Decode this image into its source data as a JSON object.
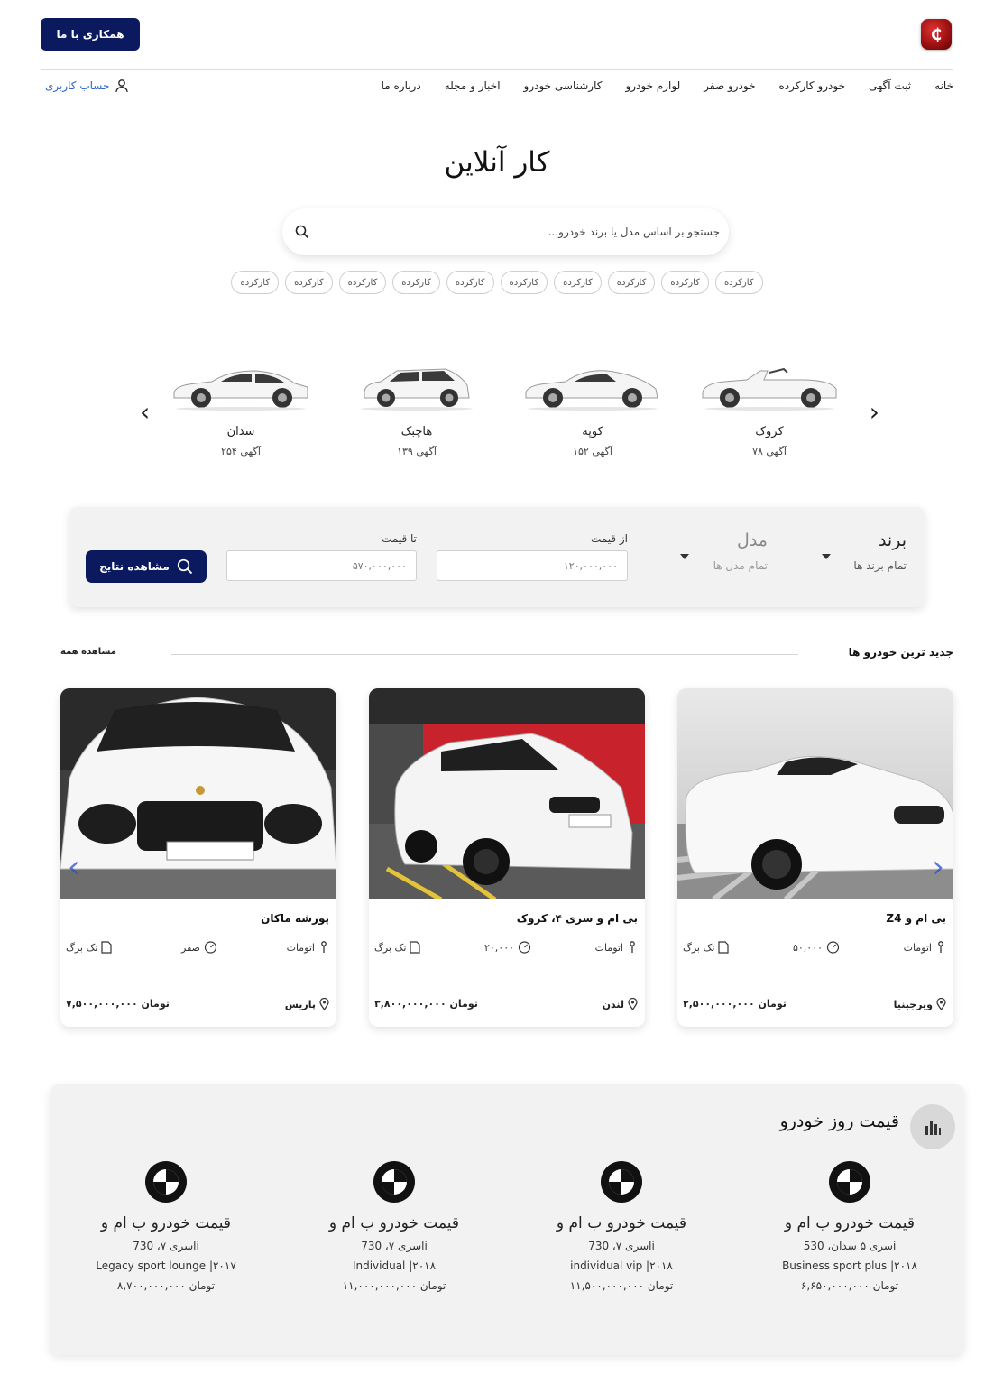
{
  "header": {
    "cta_label": "همکاری با ما",
    "logo_icon": "red-c-logo",
    "logo_glyph": "₵",
    "account_label": "حساب کاربری",
    "nav": [
      "خانه",
      "ثبت آگهی",
      "خودرو کارکرده",
      "خودرو صفر",
      "لوازم خودرو",
      "کارشناسی خودرو",
      "اخبار و مجله",
      "درباره ما"
    ]
  },
  "hero": {
    "title": "کار آنلاین",
    "search_placeholder": "جستجو بر اساس مدل یا برند خودرو...",
    "tags": [
      "کارکرده",
      "کارکرده",
      "کارکرده",
      "کارکرده",
      "کارکرده",
      "کارکرده",
      "کارکرده",
      "کارکرده",
      "کارکرده",
      "کارکرده"
    ]
  },
  "types": [
    {
      "name": "کروک",
      "count": "۷۸ آگهی"
    },
    {
      "name": "کوپه",
      "count": "۱۵۲ آگهی"
    },
    {
      "name": "هاچبک",
      "count": "۱۳۹ آگهی"
    },
    {
      "name": "سدان",
      "count": "۲۵۴ آگهی"
    }
  ],
  "filter": {
    "brand_label": "برند",
    "brand_value": "تمام برند ها",
    "model_label": "مدل",
    "model_value": "تمام مدل ها",
    "from_label": "از قیمت",
    "from_value": "۱۲۰,۰۰۰,۰۰۰",
    "to_label": "تا قیمت",
    "to_value": "۵۷۰,۰۰۰,۰۰۰",
    "results_label": "مشاهده نتایج"
  },
  "newest": {
    "title": "جدید ترین خودرو ها",
    "see_all": "مشاهده همه",
    "cards": [
      {
        "title": "بی ام و Z4",
        "gear": "اتومات",
        "km": "۵۰,۰۰۰",
        "doc": "تک برگ",
        "city": "ویرجینیا",
        "price": "۲,۵۰۰,۰۰۰,۰۰۰ تومان"
      },
      {
        "title": "بی ام و سری ۴، کروک",
        "gear": "اتومات",
        "km": "۲۰,۰۰۰",
        "doc": "تک برگ",
        "city": "لندن",
        "price": "۳,۸۰۰,۰۰۰,۰۰۰ تومان"
      },
      {
        "title": "پورشه ماکان",
        "gear": "اتومات",
        "km": "صفر",
        "doc": "تک برگ",
        "city": "پاریس",
        "price": "۷,۵۰۰,۰۰۰,۰۰۰ تومان"
      }
    ]
  },
  "daily": {
    "title": "قیمت روز خودرو",
    "items": [
      {
        "title": "قیمت خودرو ب ام و",
        "series": "سری ۵ سدان، 530i",
        "trim": "Business sport plus |۲۰۱۸",
        "price": "۶,۶۵۰,۰۰۰,۰۰۰ تومان"
      },
      {
        "title": "قیمت خودرو ب ام و",
        "series": "سری ۷، 730li",
        "trim": "individual vip |۲۰۱۸",
        "price": "۱۱,۵۰۰,۰۰۰,۰۰۰ تومان"
      },
      {
        "title": "قیمت خودرو ب ام و",
        "series": "سری ۷، 730li",
        "trim": "Individual |۲۰۱۸",
        "price": "۱۱,۰۰۰,۰۰۰,۰۰۰ تومان"
      },
      {
        "title": "قیمت خودرو ب ام و",
        "series": "سری ۷، 730li",
        "trim": "Legacy sport lounge |۲۰۱۷",
        "price": "۸,۷۰۰,۰۰۰,۰۰۰ تومان"
      }
    ]
  }
}
